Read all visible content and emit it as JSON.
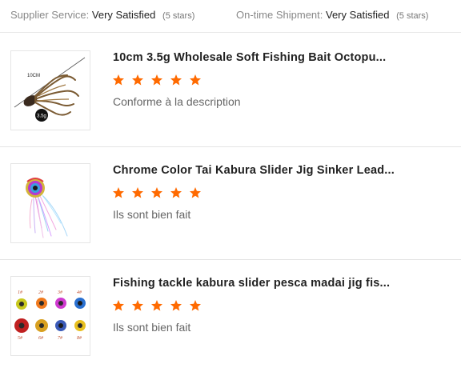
{
  "summary": {
    "supplier_label": "Supplier Service:",
    "supplier_value": "Very Satisfied",
    "supplier_stars": "(5 stars)",
    "shipment_label": "On-time Shipment:",
    "shipment_value": "Very Satisfied",
    "shipment_stars": "(5 stars)"
  },
  "colors": {
    "star": "#ff6a00",
    "title": "#222222",
    "comment": "#666666"
  },
  "reviews": [
    {
      "title": "10cm 3.5g Wholesale Soft Fishing Bait Octopu...",
      "rating": 5,
      "comment": "Conforme à la description",
      "image_text": {
        "size": "10CM",
        "weight": "3.5g"
      },
      "image_icon": "soft-octopus-bait-icon"
    },
    {
      "title": "Chrome Color Tai Kabura Slider Jig Sinker Lead...",
      "rating": 5,
      "comment": "Ils sont bien fait",
      "image_icon": "kabura-jig-icon"
    },
    {
      "title": "Fishing tackle kabura slider pesca madai jig fis...",
      "rating": 5,
      "comment": "Ils sont bien fait",
      "image_labels": [
        "1#",
        "2#",
        "3#",
        "4#",
        "5#",
        "6#",
        "7#",
        "8#"
      ],
      "image_icon": "kabura-color-chart-icon"
    }
  ]
}
